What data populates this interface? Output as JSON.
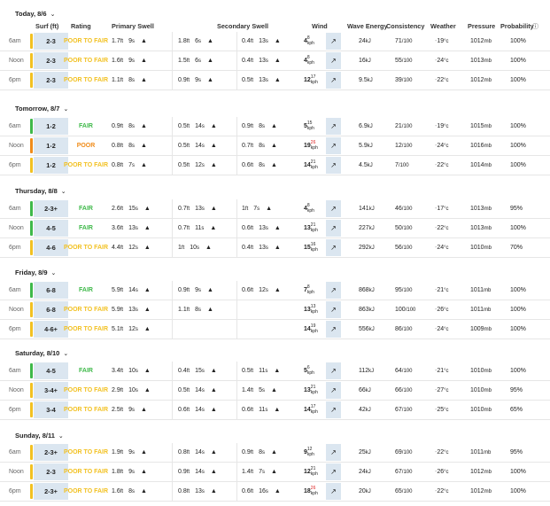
{
  "colors": {
    "fair": "#3fb94a",
    "poor": "#f08c1a",
    "poor_to_fair": "#f2c122",
    "surf_bg": "#dbe6f0"
  },
  "header": {
    "surf": "Surf (ft)",
    "rating": "Rating",
    "primary": "Primary Swell",
    "secondary": "Secondary Swell",
    "wind": "Wind",
    "energy": "Wave Energy",
    "consistency": "Consistency",
    "weather": "Weather",
    "pressure": "Pressure",
    "probability": "Probability"
  },
  "days": [
    {
      "title": "Today, 8/6",
      "rows": [
        {
          "time": "6am",
          "surf": "2-3",
          "rating": "POOR TO FAIR",
          "rating_level": "poor_to_fair",
          "p_h": "1.7",
          "p_p": "9",
          "s1_h": "1.8",
          "s1_p": "6",
          "s2_h": "0.4",
          "s2_p": "13",
          "wind": "4",
          "gust": "8",
          "wind_unit": "kph",
          "energy": "24",
          "cons": "71",
          "weather": "19",
          "pressure": "1012",
          "prob": "100%"
        },
        {
          "time": "Noon",
          "surf": "2-3",
          "rating": "POOR TO FAIR",
          "rating_level": "poor_to_fair",
          "p_h": "1.6",
          "p_p": "9",
          "s1_h": "1.5",
          "s1_p": "6",
          "s2_h": "0.4",
          "s2_p": "13",
          "wind": "4",
          "gust": "8",
          "wind_unit": "kph",
          "energy": "16",
          "cons": "55",
          "weather": "24",
          "pressure": "1013",
          "prob": "100%"
        },
        {
          "time": "6pm",
          "surf": "2-3",
          "rating": "POOR TO FAIR",
          "rating_level": "poor_to_fair",
          "p_h": "1.1",
          "p_p": "8",
          "s1_h": "0.9",
          "s1_p": "9",
          "s2_h": "0.5",
          "s2_p": "13",
          "wind": "12",
          "gust": "17",
          "wind_unit": "kph",
          "energy": "9.5",
          "cons": "39",
          "weather": "22",
          "pressure": "1012",
          "prob": "100%"
        }
      ]
    },
    {
      "title": "Tomorrow, 8/7",
      "rows": [
        {
          "time": "6am",
          "surf": "1-2",
          "rating": "FAIR",
          "rating_level": "fair",
          "p_h": "0.9",
          "p_p": "8",
          "s1_h": "0.5",
          "s1_p": "14",
          "s2_h": "0.9",
          "s2_p": "8",
          "wind": "5",
          "gust": "15",
          "wind_unit": "kph",
          "energy": "6.9",
          "cons": "21",
          "weather": "19",
          "pressure": "1015",
          "prob": "100%"
        },
        {
          "time": "Noon",
          "surf": "1-2",
          "rating": "POOR",
          "rating_level": "poor",
          "p_h": "0.8",
          "p_p": "8",
          "s1_h": "0.5",
          "s1_p": "14",
          "s2_h": "0.7",
          "s2_p": "8",
          "wind": "19",
          "gust": "26",
          "wind_unit": "kph",
          "energy": "5.9",
          "cons": "12",
          "weather": "24",
          "pressure": "1016",
          "prob": "100%"
        },
        {
          "time": "6pm",
          "surf": "1-2",
          "rating": "POOR TO FAIR",
          "rating_level": "poor_to_fair",
          "p_h": "0.8",
          "p_p": "7",
          "s1_h": "0.5",
          "s1_p": "12",
          "s2_h": "0.6",
          "s2_p": "8",
          "wind": "14",
          "gust": "21",
          "wind_unit": "kph",
          "energy": "4.5",
          "cons": "7",
          "weather": "22",
          "pressure": "1014",
          "prob": "100%"
        }
      ]
    },
    {
      "title": "Thursday, 8/8",
      "rows": [
        {
          "time": "6am",
          "surf": "2-3+",
          "rating": "FAIR",
          "rating_level": "fair",
          "p_h": "2.6",
          "p_p": "15",
          "s1_h": "0.7",
          "s1_p": "13",
          "s2_h": "1",
          "s2_p": "7",
          "wind": "4",
          "gust": "8",
          "wind_unit": "kph",
          "energy": "141",
          "cons": "46",
          "weather": "17",
          "pressure": "1013",
          "prob": "95%"
        },
        {
          "time": "Noon",
          "surf": "4-5",
          "rating": "FAIR",
          "rating_level": "fair",
          "p_h": "3.6",
          "p_p": "13",
          "s1_h": "0.7",
          "s1_p": "11",
          "s2_h": "0.6",
          "s2_p": "13",
          "wind": "13",
          "gust": "21",
          "wind_unit": "kph",
          "energy": "227",
          "cons": "50",
          "weather": "22",
          "pressure": "1013",
          "prob": "100%"
        },
        {
          "time": "6pm",
          "surf": "4-6",
          "rating": "POOR TO FAIR",
          "rating_level": "poor_to_fair",
          "p_h": "4.4",
          "p_p": "12",
          "s1_h": "1",
          "s1_p": "10",
          "s2_h": "0.4",
          "s2_p": "13",
          "wind": "15",
          "gust": "16",
          "wind_unit": "kph",
          "energy": "292",
          "cons": "56",
          "weather": "24",
          "pressure": "1010",
          "prob": "70%"
        }
      ]
    },
    {
      "title": "Friday, 8/9",
      "rows": [
        {
          "time": "6am",
          "surf": "6-8",
          "rating": "FAIR",
          "rating_level": "fair",
          "p_h": "5.9",
          "p_p": "14",
          "s1_h": "0.9",
          "s1_p": "9",
          "s2_h": "0.6",
          "s2_p": "12",
          "wind": "7",
          "gust": "8",
          "wind_unit": "kph",
          "energy": "868",
          "cons": "95",
          "weather": "21",
          "pressure": "1011",
          "prob": "100%"
        },
        {
          "time": "Noon",
          "surf": "6-8",
          "rating": "POOR TO FAIR",
          "rating_level": "poor_to_fair",
          "p_h": "5.9",
          "p_p": "13",
          "s1_h": "1.1",
          "s1_p": "8",
          "s2_h": "",
          "s2_p": "",
          "wind": "13",
          "gust": "13",
          "wind_unit": "kph",
          "energy": "863",
          "cons": "100",
          "weather": "26",
          "pressure": "1011",
          "prob": "100%"
        },
        {
          "time": "6pm",
          "surf": "4-6+",
          "rating": "POOR TO FAIR",
          "rating_level": "poor_to_fair",
          "p_h": "5.1",
          "p_p": "12",
          "s1_h": "",
          "s1_p": "",
          "s2_h": "",
          "s2_p": "",
          "wind": "14",
          "gust": "19",
          "wind_unit": "kph",
          "energy": "556",
          "cons": "86",
          "weather": "24",
          "pressure": "1009",
          "prob": "100%"
        }
      ]
    },
    {
      "title": "Saturday, 8/10",
      "rows": [
        {
          "time": "6am",
          "surf": "4-5",
          "rating": "FAIR",
          "rating_level": "fair",
          "p_h": "3.4",
          "p_p": "10",
          "s1_h": "0.4",
          "s1_p": "15",
          "s2_h": "0.5",
          "s2_p": "11",
          "wind": "5",
          "gust": "6",
          "wind_unit": "kph",
          "energy": "112",
          "cons": "64",
          "weather": "21",
          "pressure": "1010",
          "prob": "100%"
        },
        {
          "time": "Noon",
          "surf": "3-4+",
          "rating": "POOR TO FAIR",
          "rating_level": "poor_to_fair",
          "p_h": "2.9",
          "p_p": "10",
          "s1_h": "0.5",
          "s1_p": "14",
          "s2_h": "1.4",
          "s2_p": "5",
          "wind": "13",
          "gust": "21",
          "wind_unit": "kph",
          "energy": "66",
          "cons": "66",
          "weather": "27",
          "pressure": "1010",
          "prob": "95%"
        },
        {
          "time": "6pm",
          "surf": "3-4",
          "rating": "POOR TO FAIR",
          "rating_level": "poor_to_fair",
          "p_h": "2.5",
          "p_p": "9",
          "s1_h": "0.6",
          "s1_p": "14",
          "s2_h": "0.6",
          "s2_p": "11",
          "wind": "14",
          "gust": "17",
          "wind_unit": "kph",
          "energy": "42",
          "cons": "67",
          "weather": "25",
          "pressure": "1010",
          "prob": "65%"
        }
      ]
    },
    {
      "title": "Sunday, 8/11",
      "rows": [
        {
          "time": "6am",
          "surf": "2-3+",
          "rating": "POOR TO FAIR",
          "rating_level": "poor_to_fair",
          "p_h": "1.9",
          "p_p": "9",
          "s1_h": "0.8",
          "s1_p": "14",
          "s2_h": "0.9",
          "s2_p": "8",
          "wind": "9",
          "gust": "12",
          "wind_unit": "kph",
          "energy": "25",
          "cons": "69",
          "weather": "22",
          "pressure": "1011",
          "prob": "95%"
        },
        {
          "time": "Noon",
          "surf": "2-3",
          "rating": "POOR TO FAIR",
          "rating_level": "poor_to_fair",
          "p_h": "1.8",
          "p_p": "9",
          "s1_h": "0.9",
          "s1_p": "14",
          "s2_h": "1.4",
          "s2_p": "7",
          "wind": "12",
          "gust": "21",
          "wind_unit": "kph",
          "energy": "24",
          "cons": "67",
          "weather": "26",
          "pressure": "1012",
          "prob": "100%"
        },
        {
          "time": "6pm",
          "surf": "2-3+",
          "rating": "POOR TO FAIR",
          "rating_level": "poor_to_fair",
          "p_h": "1.6",
          "p_p": "8",
          "s1_h": "0.8",
          "s1_p": "13",
          "s2_h": "0.6",
          "s2_p": "16",
          "wind": "18",
          "gust": "26",
          "wind_unit": "kph",
          "energy": "20",
          "cons": "65",
          "weather": "22",
          "pressure": "1012",
          "prob": "100%"
        }
      ]
    }
  ]
}
